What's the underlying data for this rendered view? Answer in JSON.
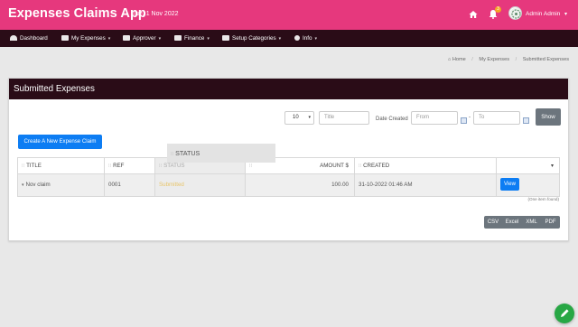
{
  "header": {
    "title": "Expenses Claims App",
    "date": "Tue, 1 Nov 2022",
    "notification_count": "3",
    "user_name": "Admin Admin",
    "icons": [
      "home-icon",
      "bell-icon"
    ]
  },
  "nav": {
    "items": [
      {
        "label": "Dashboard",
        "icon": "dashboard-icon"
      },
      {
        "label": "My Expenses",
        "icon": "wallet-icon"
      },
      {
        "label": "Approver",
        "icon": "approver-icon"
      },
      {
        "label": "Finance",
        "icon": "finance-icon"
      },
      {
        "label": "Setup Categories",
        "icon": "list-icon"
      },
      {
        "label": "Info",
        "icon": "info-icon"
      }
    ]
  },
  "breadcrumb": [
    "Home",
    "My Expenses",
    "Submitted Expenses"
  ],
  "panel": {
    "title": "Submitted Expenses"
  },
  "filters": {
    "page_size": "10",
    "title_placeholder": "Title",
    "date_created_label": "Date Created",
    "from_placeholder": "From",
    "dash": "-",
    "to_placeholder": "To",
    "show_label": "Show"
  },
  "actions": {
    "create_label": "Create A New Expense Claim"
  },
  "drag_column": "STATUS",
  "table": {
    "columns": [
      "TITLE",
      "REF",
      "STATUS",
      "AMOUNT $",
      "CREATED"
    ],
    "rows": [
      {
        "title": "Nov claim",
        "ref": "0001",
        "status": "Submitted",
        "amount": "100.00",
        "created": "31-10-2022 01:46 AM",
        "action": "View"
      }
    ],
    "item_count": "(One item found)"
  },
  "export": [
    "CSV",
    "Excel",
    "XML",
    "PDF"
  ],
  "colors": {
    "topbar": "#e6387d",
    "navbar": "#2a0c17",
    "primary": "#0d7df3",
    "secondary": "#6c757d",
    "fab": "#28a745",
    "status_submitted": "#e8c56a"
  }
}
